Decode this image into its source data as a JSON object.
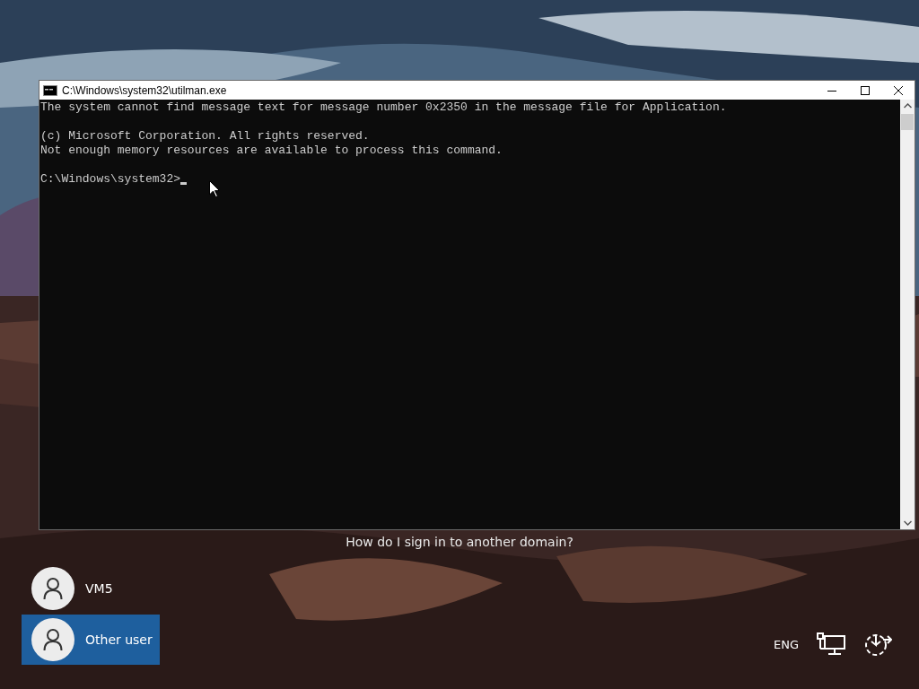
{
  "help_link": "How do I sign in to another domain?",
  "console_window": {
    "title": "C:\\Windows\\system32\\utilman.exe",
    "blocks": [
      [
        "The system cannot find message text for message number 0x2350 in the message file for Application."
      ],
      [
        "(c) Microsoft Corporation. All rights reserved.",
        "Not enough memory resources are available to process this command."
      ],
      [
        "C:\\Windows\\system32>"
      ]
    ]
  },
  "users": [
    {
      "name": "VM5",
      "selected": false
    },
    {
      "name": "Other user",
      "selected": true
    }
  ],
  "language": "ENG"
}
